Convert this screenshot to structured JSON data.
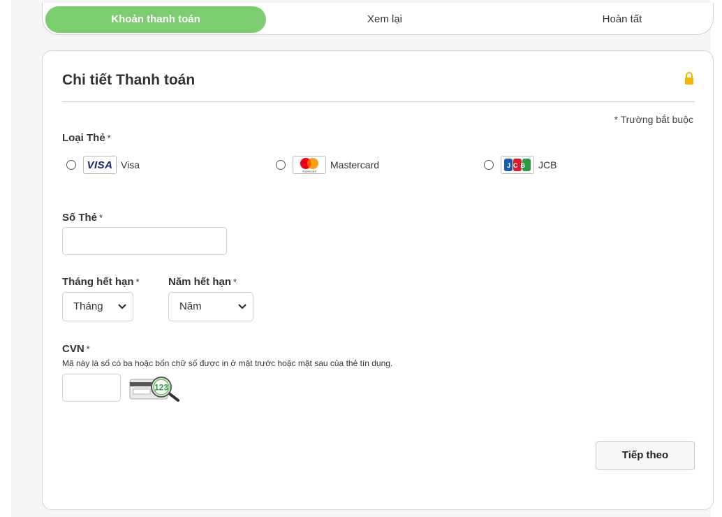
{
  "stepper": {
    "steps": [
      {
        "label": "Khoản thanh toán",
        "state": "active"
      },
      {
        "label": "Xem lại",
        "state": "pending"
      },
      {
        "label": "Hoàn tất",
        "state": "pending"
      }
    ]
  },
  "card": {
    "title": "Chi tiết Thanh toán",
    "lock_icon": "lock-icon",
    "required_note": "* Trường bắt buộc"
  },
  "card_type": {
    "label": "Loại Thẻ",
    "star": "*",
    "options": [
      {
        "label": "Visa",
        "logo_text": "VISA",
        "selected": false
      },
      {
        "label": "Mastercard",
        "logo_text": "mastercard",
        "selected": false
      },
      {
        "label": "JCB",
        "logo_text": "JCB",
        "selected": false
      }
    ]
  },
  "card_number": {
    "label": "Số Thẻ",
    "star": "*",
    "value": ""
  },
  "expiry_month": {
    "label": "Tháng hết hạn",
    "star": "*",
    "selected": "Tháng"
  },
  "expiry_year": {
    "label": "Năm hết hạn",
    "star": "*",
    "selected": "Năm"
  },
  "cvn": {
    "label": "CVN",
    "star": "*",
    "help": "Mã này là số có ba hoặc bốn chữ số được in ở mặt trước hoặc mặt sau của thẻ tín dụng.",
    "value": "",
    "icon_text": "123"
  },
  "actions": {
    "next_label": "Tiếp theo"
  },
  "colors": {
    "accent": "#7ccc70",
    "lock": "#f2b600",
    "visa": "#1a1f71",
    "jcb_blue": "#1f5aa6",
    "jcb_red": "#d81e2c",
    "jcb_green": "#2f9a44"
  }
}
